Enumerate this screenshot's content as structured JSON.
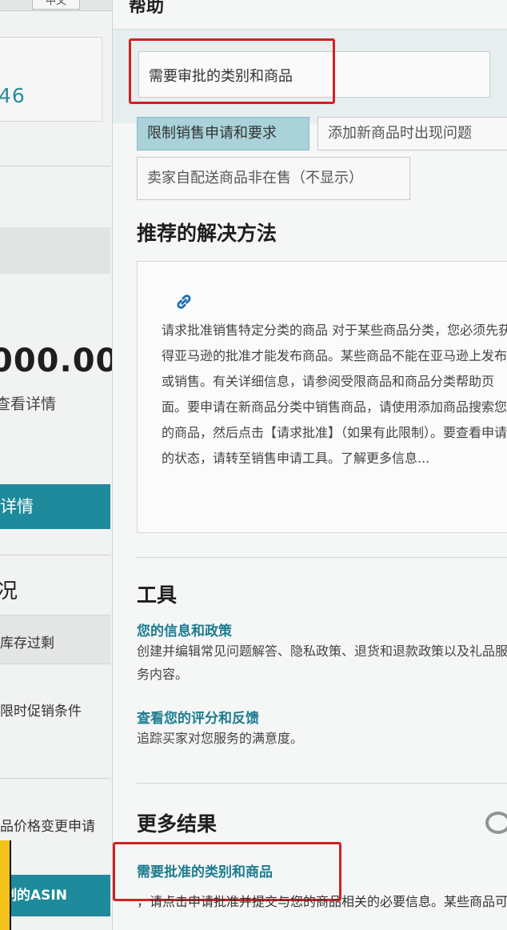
{
  "left": {
    "tab_label": "中文",
    "count_fragment": "46",
    "amount_fragment": "000.00",
    "detail_link": "查看详情",
    "button1_label": "详情",
    "section_fragment": "况",
    "row1": "库存过剩",
    "row2": "限时促销条件",
    "row3": "品价格变更申请",
    "button2_label": "制的ASIN"
  },
  "help": {
    "title": "帮助",
    "search_value": "需要审批的类别和商品",
    "chips": [
      "限制销售申请和要求",
      "添加新商品时出现问题",
      "卖家自配送商品非在售（不显示）"
    ],
    "recommended_heading": "推荐的解决方法",
    "recommended_text": "请求批准销售特定分类的商品 对于某些商品分类，您必须先获得亚马逊的批准才能发布商品。某些商品不能在亚马逊上发布或销售。有关详细信息，请参阅受限商品和商品分类帮助页面。要申请在新商品分类中销售商品，请使用添加商品搜索您的商品，然后点击【请求批准】（如果有此限制）。要查看申请的状态，请转至销售申请工具。了解更多信息...",
    "tools_heading": "工具",
    "tools": [
      {
        "link": "您的信息和政策",
        "desc": "创建并编辑常见问题解答、隐私政策、退货和退款政策以及礼品服务内容。"
      },
      {
        "link": "查看您的评分和反馈",
        "desc": "追踪买家对您服务的满意度。"
      }
    ],
    "more_heading": "更多结果",
    "more_link": "需要批准的类别和商品",
    "more_text": "，请点击申请批准并提交与您的商品相关的必要信息。某些商品可能会在 ASIN、品牌或子分类等方面有额外要求。"
  }
}
